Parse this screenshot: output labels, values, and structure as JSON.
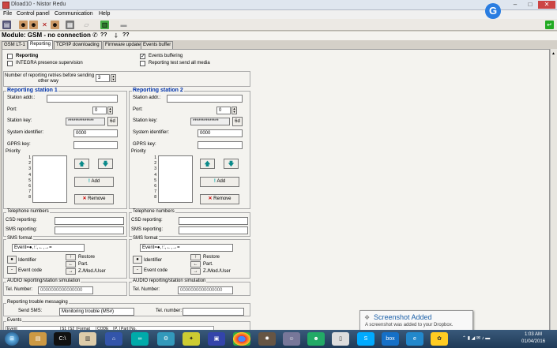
{
  "window": {
    "title": "Dload10 - Nistor Redu",
    "min": "–",
    "max": "□",
    "close": "✕"
  },
  "menu": [
    "File",
    "Control panel",
    "Communication",
    "Help"
  ],
  "module": {
    "label": "Module: GSM - no connection",
    "q1": "??",
    "q2": "??"
  },
  "tabs": [
    "GSM LT-1",
    "Reporting",
    "TCP/IP downloading",
    "Firmware update",
    "Events buffer"
  ],
  "reporting": {
    "reporting_label": "Reporting",
    "integra_label": "INTEGRA presence supervision",
    "events_buffering_label": "Events buffering",
    "events_buffering_checked": "✓",
    "report_test_label": "Reporting test send all media",
    "retries_label_1": "Number of reporting retries before sending",
    "retries_label_2": "other way",
    "retries_value": "3"
  },
  "station1": {
    "title": "Reporting station 1",
    "addr_label": "Station addr.:",
    "port_label": "Port:",
    "port_value": "0",
    "key_label": "Station key:",
    "key_value": "**************",
    "key_btn": "6d",
    "sysid_label": "System identifier:",
    "sysid_value": "0000",
    "gprs_label": "GPRS key:",
    "priority_label": "Priority",
    "add_label": "Add",
    "remove_label": "Remove"
  },
  "station2": {
    "title": "Reporting station 2",
    "addr_label": "Station addr.:",
    "port_label": "Port:",
    "port_value": "0",
    "key_label": "Station key:",
    "key_value": "**************",
    "key_btn": "6d",
    "sysid_label": "System identifier:",
    "sysid_value": "0000",
    "gprs_label": "GPRS key:",
    "priority_label": "Priority",
    "add_label": "Add",
    "remove_label": "Remove"
  },
  "priority_numbers": [
    "1",
    "2",
    "3",
    "4",
    "5",
    "6",
    "7",
    "8"
  ],
  "telephone": {
    "title": "Telephone numbers",
    "csd_label": "CSD reporting:",
    "sms_label": "SMS reporting:"
  },
  "sms_format": {
    "title": "SMS format",
    "value": "Event=●,↑:,←,→=",
    "identifier_label": "Identifier",
    "event_code_label": "Event code",
    "restore_label": "Restore",
    "part_label": "Part.",
    "zmod_label": "Z./Mod./User",
    "dot": "●",
    "dash": "-"
  },
  "audio": {
    "title": "AUDIO reporting/station simulation",
    "tel_label": "Tel. Number:",
    "tel_value": "0000000000000000"
  },
  "trouble": {
    "title": "Reporting trouble messaging",
    "send_sms_label": "Send SMS:",
    "send_sms_value": "Monitoring trouble (MS#)",
    "tel_label": "Tel. number:"
  },
  "events": {
    "title": "Events",
    "columns": [
      "Event",
      "S1",
      "S2",
      "Format",
      "CODE",
      "P.",
      "Part",
      "No."
    ]
  },
  "toast": {
    "title": "Screenshot Added",
    "body": "A screenshot was added to your Dropbox."
  },
  "tray": {
    "time": "1:03 AM",
    "date": "01/04/2016"
  },
  "taskbar_icons": [
    "start",
    "explorer",
    "terminal",
    "files",
    "network",
    "arduino",
    "settings",
    "dropbox",
    "chrome",
    "gear",
    "user",
    "chat",
    "skype",
    "box",
    "ie",
    "app"
  ],
  "colors": {
    "accent": "#0033aa",
    "taskbar": "#2b4a6b"
  }
}
